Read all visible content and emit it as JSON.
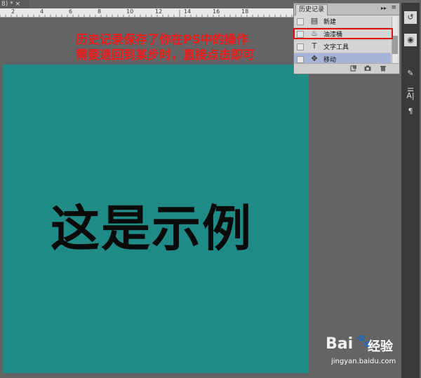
{
  "tab": {
    "label": "8) * ×"
  },
  "ruler": {
    "labels": [
      "2",
      "4",
      "6",
      "8",
      "10",
      "12",
      "14",
      "16",
      "18"
    ]
  },
  "canvas": {
    "text": "这是示例",
    "color": "#1f8a86"
  },
  "history_panel": {
    "tab_label": "历史记录",
    "controls": "▸▸",
    "menu": "≡",
    "items": [
      {
        "label": "新建",
        "icon": "document-icon",
        "glyph": "▤"
      },
      {
        "label": "油漆桶",
        "icon": "paint-bucket-icon",
        "glyph": "♨"
      },
      {
        "label": "文字工具",
        "icon": "type-tool-icon",
        "glyph": "T"
      },
      {
        "label": "移动",
        "icon": "move-tool-icon",
        "glyph": "✥"
      }
    ],
    "selected_index": 3,
    "highlight_color": "#e01010"
  },
  "annotation": {
    "line1": "历史记录保存了你在PS中的操作",
    "line2": "需要退回到某步时，直接点击即可",
    "color": "#ee1b1b"
  },
  "tools": [
    {
      "icon": "history-icon",
      "glyph": "↺"
    },
    {
      "icon": "swatches-icon",
      "glyph": "◉"
    },
    {
      "icon": "brushes-icon",
      "glyph": "✎"
    },
    {
      "icon": "sliders-icon",
      "glyph": "⚌"
    },
    {
      "icon": "character-icon",
      "glyph": "A|"
    },
    {
      "icon": "paragraph-icon",
      "glyph": "¶"
    }
  ],
  "watermark": {
    "logo": "Bai",
    "paw": "🐾",
    "cn": "经验",
    "url": "jingyan.baidu.com"
  }
}
